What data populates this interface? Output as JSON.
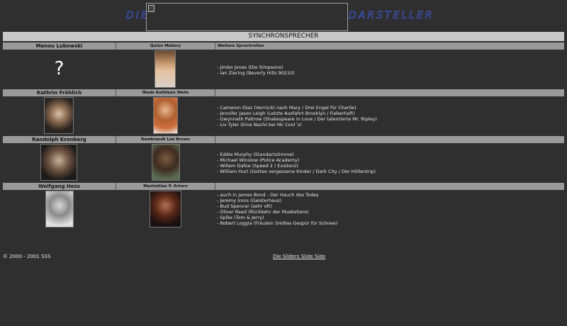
{
  "header": {
    "left_word": "DIE",
    "right_word": "DARSTELLER",
    "logo_color": "#3a52b5"
  },
  "section_title": "SYNCHRONSPRECHER",
  "rows": [
    {
      "speaker": "Manou Lubowski",
      "speaker_photo": "?",
      "actor": "Quinn Mallory",
      "roles_header": "Weitere Sprechrollen",
      "roles": [
        "- Jimbo Jones (Die Simpsons)",
        "- Ian Ziering (Beverly Hills 90210)"
      ]
    },
    {
      "speaker": "Kathrin Fröhlich",
      "actor": "Wade Kathleen Welis",
      "roles_header": "",
      "roles": [
        "- Cameron Diaz (Verrückt nach Mary / Drei Engel für Charlie)",
        "- Jennifer Jason Leigh (Letzte Ausfahrt Brooklyn / Fieberhaft)",
        "- Gwynneth Paltrow (Shakespeare in Love / Der talentierte Mr. Ripley)",
        "- Liv Tyler (Eine Nacht bei Mc Cool´s)"
      ]
    },
    {
      "speaker": "Randolph Kronberg",
      "actor": "Rembrandt Lee Brown",
      "roles_header": "",
      "roles": [
        "- Eddie Murphy (Standartstimme)",
        "- Michael Winslow (Police Academy)",
        "- Willem Dafoe (Speed 2 / Existenz)",
        "- William Hurt (Gottes vergessene Kinder / Dark City / Der Höllentrip)"
      ]
    },
    {
      "speaker": "Wolfgang Hess",
      "actor": "Maximilian P. Arturo",
      "roles_header": "",
      "roles": [
        "- auch in James Bond - Der Hauch des Todes",
        "- Jeremy Irons (Geisterhaus)",
        "- Bud Spencer (sehr oft)",
        "- Oliver Reed (Rückkehr der Musketiere)",
        "- Spike (Tom & Jerry)",
        "- Robert Loggia (Fräulein Smillas Gespür für Schnee)"
      ]
    }
  ],
  "footer": {
    "copyright": "© 2000 - 2001 SSS",
    "link": "Die Sliders Slide Side"
  },
  "colors": {
    "background": "#2f2f2f",
    "header_bar": "#9a9a9a",
    "title_bar": "#c8c8c8"
  }
}
